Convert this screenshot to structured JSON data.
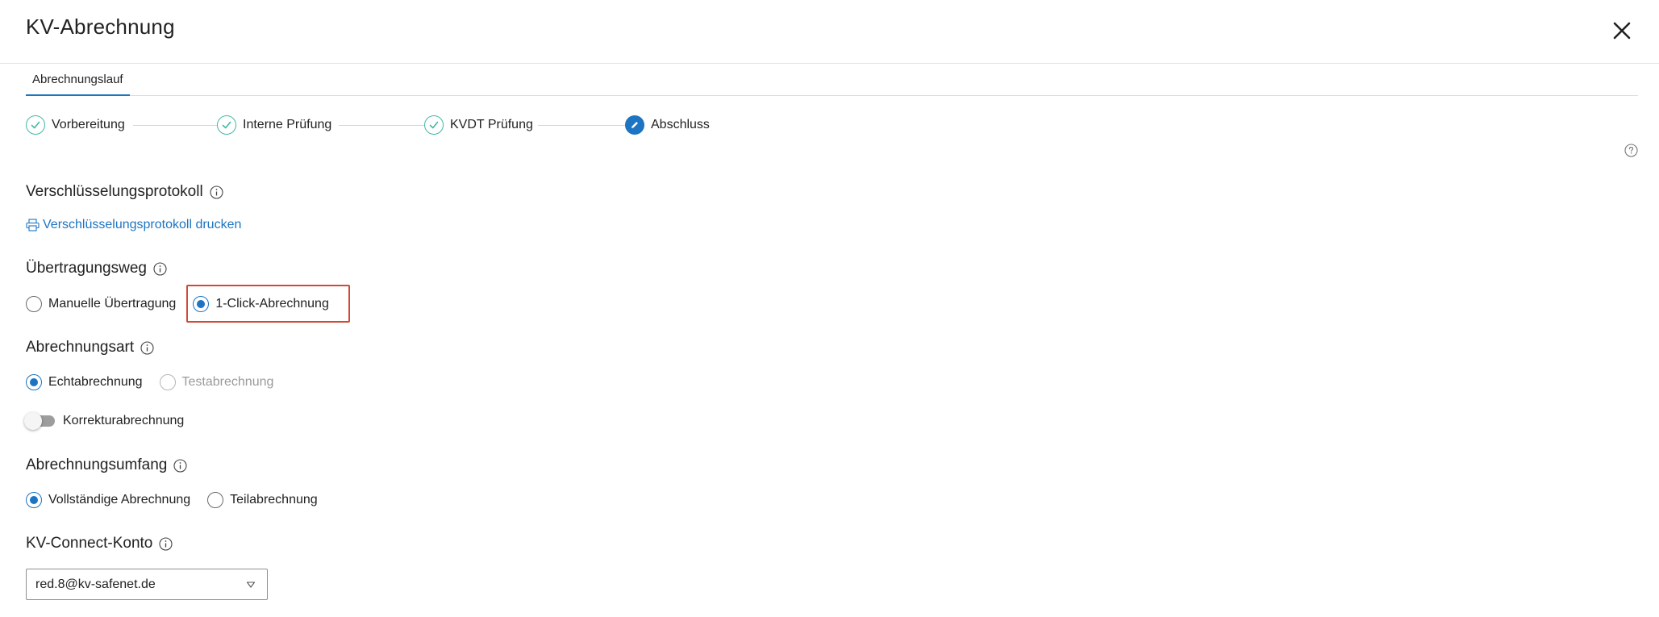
{
  "header": {
    "title": "KV-Abrechnung"
  },
  "tabs": [
    {
      "label": "Abrechnungslauf",
      "active": true
    }
  ],
  "stepper": {
    "steps": [
      {
        "label": "Vorbereitung",
        "state": "done"
      },
      {
        "label": "Interne Prüfung",
        "state": "done"
      },
      {
        "label": "KVDT Prüfung",
        "state": "done"
      },
      {
        "label": "Abschluss",
        "state": "active"
      }
    ]
  },
  "sections": {
    "encryption": {
      "heading": "Verschlüsselungsprotokoll",
      "print_link": "Verschlüsselungsprotokoll drucken"
    },
    "transfer": {
      "heading": "Übertragungsweg",
      "options": [
        {
          "label": "Manuelle Übertragung",
          "checked": false
        },
        {
          "label": "1-Click-Abrechnung",
          "checked": true
        }
      ]
    },
    "billing_type": {
      "heading": "Abrechnungsart",
      "options": [
        {
          "label": "Echtabrechnung",
          "checked": true
        },
        {
          "label": "Testabrechnung",
          "checked": false,
          "disabled": true
        }
      ],
      "correction_toggle": {
        "label": "Korrekturabrechnung",
        "on": false
      }
    },
    "scope": {
      "heading": "Abrechnungsumfang",
      "options": [
        {
          "label": "Vollständige Abrechnung",
          "checked": true
        },
        {
          "label": "Teilabrechnung",
          "checked": false
        }
      ]
    },
    "account": {
      "heading": "KV-Connect-Konto",
      "selected": "red.8@kv-safenet.de"
    }
  },
  "colors": {
    "accent": "#1c74c2",
    "success": "#41b8a6",
    "highlight": "#d04a34"
  }
}
